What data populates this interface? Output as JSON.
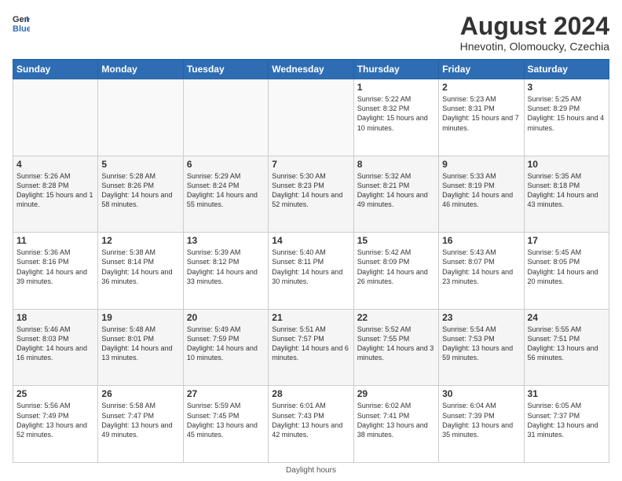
{
  "logo": {
    "general": "General",
    "blue": "Blue"
  },
  "title": "August 2024",
  "subtitle": "Hnevotin, Olomoucky, Czechia",
  "footer": "Daylight hours",
  "weekdays": [
    "Sunday",
    "Monday",
    "Tuesday",
    "Wednesday",
    "Thursday",
    "Friday",
    "Saturday"
  ],
  "weeks": [
    [
      {
        "day": "",
        "sunrise": "",
        "sunset": "",
        "daylight": "",
        "empty": true
      },
      {
        "day": "",
        "sunrise": "",
        "sunset": "",
        "daylight": "",
        "empty": true
      },
      {
        "day": "",
        "sunrise": "",
        "sunset": "",
        "daylight": "",
        "empty": true
      },
      {
        "day": "",
        "sunrise": "",
        "sunset": "",
        "daylight": "",
        "empty": true
      },
      {
        "day": "1",
        "sunrise": "5:22 AM",
        "sunset": "8:32 PM",
        "daylight": "15 hours and 10 minutes."
      },
      {
        "day": "2",
        "sunrise": "5:23 AM",
        "sunset": "8:31 PM",
        "daylight": "15 hours and 7 minutes."
      },
      {
        "day": "3",
        "sunrise": "5:25 AM",
        "sunset": "8:29 PM",
        "daylight": "15 hours and 4 minutes."
      }
    ],
    [
      {
        "day": "4",
        "sunrise": "5:26 AM",
        "sunset": "8:28 PM",
        "daylight": "15 hours and 1 minute."
      },
      {
        "day": "5",
        "sunrise": "5:28 AM",
        "sunset": "8:26 PM",
        "daylight": "14 hours and 58 minutes."
      },
      {
        "day": "6",
        "sunrise": "5:29 AM",
        "sunset": "8:24 PM",
        "daylight": "14 hours and 55 minutes."
      },
      {
        "day": "7",
        "sunrise": "5:30 AM",
        "sunset": "8:23 PM",
        "daylight": "14 hours and 52 minutes."
      },
      {
        "day": "8",
        "sunrise": "5:32 AM",
        "sunset": "8:21 PM",
        "daylight": "14 hours and 49 minutes."
      },
      {
        "day": "9",
        "sunrise": "5:33 AM",
        "sunset": "8:19 PM",
        "daylight": "14 hours and 46 minutes."
      },
      {
        "day": "10",
        "sunrise": "5:35 AM",
        "sunset": "8:18 PM",
        "daylight": "14 hours and 43 minutes."
      }
    ],
    [
      {
        "day": "11",
        "sunrise": "5:36 AM",
        "sunset": "8:16 PM",
        "daylight": "14 hours and 39 minutes."
      },
      {
        "day": "12",
        "sunrise": "5:38 AM",
        "sunset": "8:14 PM",
        "daylight": "14 hours and 36 minutes."
      },
      {
        "day": "13",
        "sunrise": "5:39 AM",
        "sunset": "8:12 PM",
        "daylight": "14 hours and 33 minutes."
      },
      {
        "day": "14",
        "sunrise": "5:40 AM",
        "sunset": "8:11 PM",
        "daylight": "14 hours and 30 minutes."
      },
      {
        "day": "15",
        "sunrise": "5:42 AM",
        "sunset": "8:09 PM",
        "daylight": "14 hours and 26 minutes."
      },
      {
        "day": "16",
        "sunrise": "5:43 AM",
        "sunset": "8:07 PM",
        "daylight": "14 hours and 23 minutes."
      },
      {
        "day": "17",
        "sunrise": "5:45 AM",
        "sunset": "8:05 PM",
        "daylight": "14 hours and 20 minutes."
      }
    ],
    [
      {
        "day": "18",
        "sunrise": "5:46 AM",
        "sunset": "8:03 PM",
        "daylight": "14 hours and 16 minutes."
      },
      {
        "day": "19",
        "sunrise": "5:48 AM",
        "sunset": "8:01 PM",
        "daylight": "14 hours and 13 minutes."
      },
      {
        "day": "20",
        "sunrise": "5:49 AM",
        "sunset": "7:59 PM",
        "daylight": "14 hours and 10 minutes."
      },
      {
        "day": "21",
        "sunrise": "5:51 AM",
        "sunset": "7:57 PM",
        "daylight": "14 hours and 6 minutes."
      },
      {
        "day": "22",
        "sunrise": "5:52 AM",
        "sunset": "7:55 PM",
        "daylight": "14 hours and 3 minutes."
      },
      {
        "day": "23",
        "sunrise": "5:54 AM",
        "sunset": "7:53 PM",
        "daylight": "13 hours and 59 minutes."
      },
      {
        "day": "24",
        "sunrise": "5:55 AM",
        "sunset": "7:51 PM",
        "daylight": "13 hours and 56 minutes."
      }
    ],
    [
      {
        "day": "25",
        "sunrise": "5:56 AM",
        "sunset": "7:49 PM",
        "daylight": "13 hours and 52 minutes."
      },
      {
        "day": "26",
        "sunrise": "5:58 AM",
        "sunset": "7:47 PM",
        "daylight": "13 hours and 49 minutes."
      },
      {
        "day": "27",
        "sunrise": "5:59 AM",
        "sunset": "7:45 PM",
        "daylight": "13 hours and 45 minutes."
      },
      {
        "day": "28",
        "sunrise": "6:01 AM",
        "sunset": "7:43 PM",
        "daylight": "13 hours and 42 minutes."
      },
      {
        "day": "29",
        "sunrise": "6:02 AM",
        "sunset": "7:41 PM",
        "daylight": "13 hours and 38 minutes."
      },
      {
        "day": "30",
        "sunrise": "6:04 AM",
        "sunset": "7:39 PM",
        "daylight": "13 hours and 35 minutes."
      },
      {
        "day": "31",
        "sunrise": "6:05 AM",
        "sunset": "7:37 PM",
        "daylight": "13 hours and 31 minutes."
      }
    ]
  ]
}
